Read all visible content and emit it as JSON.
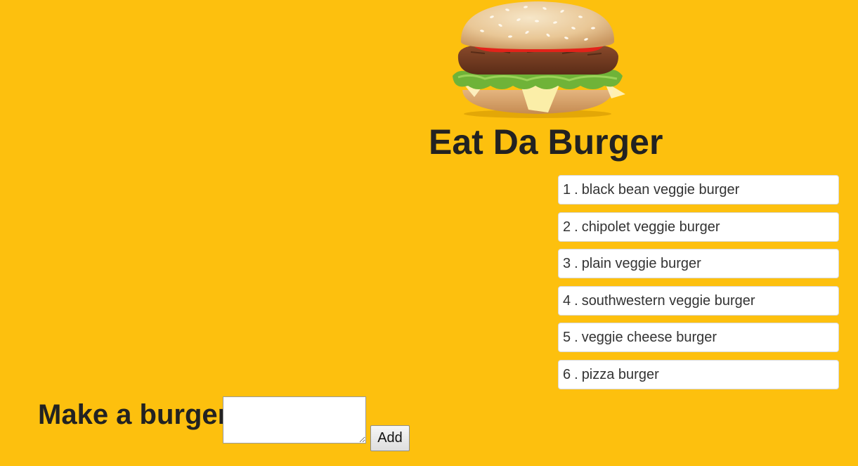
{
  "header": {
    "logo_icon": "burger-image",
    "title": "Eat Da Burger"
  },
  "burgers": [
    {
      "id": "1",
      "name": "black bean veggie burger"
    },
    {
      "id": "2",
      "name": "chipolet veggie burger"
    },
    {
      "id": "3",
      "name": "plain veggie burger"
    },
    {
      "id": "4",
      "name": "southwestern veggie burger"
    },
    {
      "id": "5",
      "name": "veggie cheese burger"
    },
    {
      "id": "6",
      "name": "pizza burger"
    }
  ],
  "list_separator": ".",
  "form": {
    "label": "Make a burger",
    "input_value": "",
    "button_label": "Add"
  },
  "colors": {
    "background": "#fdc00e",
    "list_item_bg": "#ffffff",
    "text": "#212529"
  }
}
